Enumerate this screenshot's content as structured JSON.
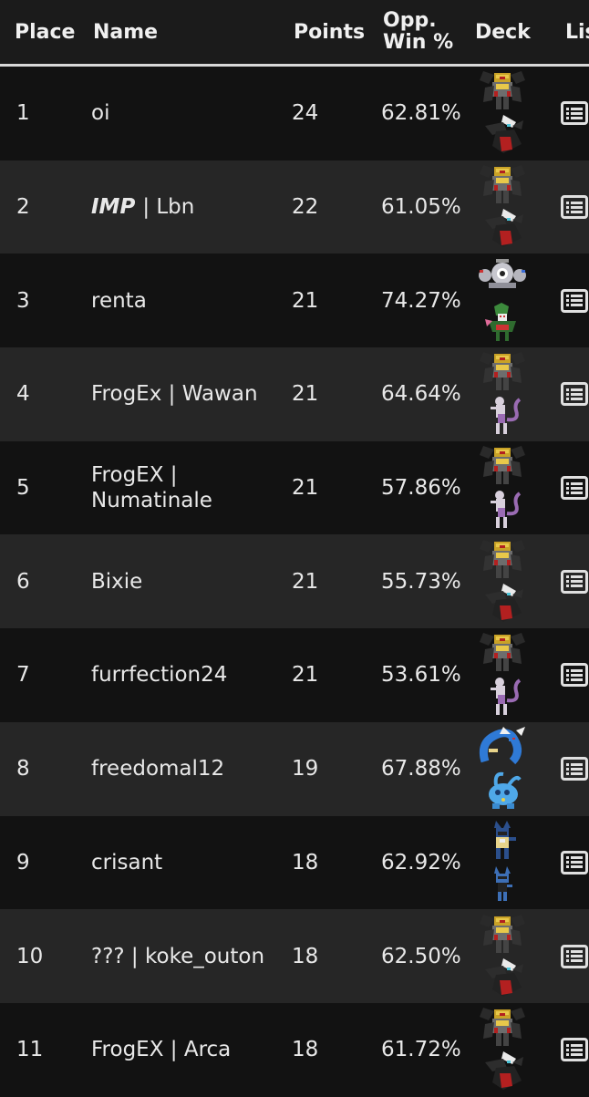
{
  "header": {
    "place": "Place",
    "name": "Name",
    "points": "Points",
    "opp_line1": "Opp.",
    "opp_line2": "Win %",
    "deck": "Deck",
    "list": "Lis"
  },
  "rows": [
    {
      "place": "1",
      "team": "",
      "name": "oi",
      "points": "24",
      "opp": "62.81%",
      "deck": [
        "giratina-sprite",
        "darkrai-sprite"
      ]
    },
    {
      "place": "2",
      "team": "IMP",
      "name": "| Lbn",
      "points": "22",
      "opp": "61.05%",
      "deck": [
        "giratina-sprite",
        "darkrai-sprite"
      ]
    },
    {
      "place": "3",
      "team": "",
      "name": "renta",
      "points": "21",
      "opp": "74.27%",
      "deck": [
        "magnezone-sprite",
        "meowscarada-sprite"
      ]
    },
    {
      "place": "4",
      "team": "",
      "name": "FrogEx | Wawan",
      "points": "21",
      "opp": "64.64%",
      "deck": [
        "giratina-sprite",
        "mewtwo-sprite"
      ]
    },
    {
      "place": "5",
      "team": "",
      "name": "FrogEX | Numatinale",
      "points": "21",
      "opp": "57.86%",
      "deck": [
        "giratina-sprite",
        "mewtwo-sprite"
      ]
    },
    {
      "place": "6",
      "team": "",
      "name": "Bixie",
      "points": "21",
      "opp": "55.73%",
      "deck": [
        "giratina-sprite",
        "darkrai-sprite"
      ]
    },
    {
      "place": "7",
      "team": "",
      "name": "furrfection24",
      "points": "21",
      "opp": "53.61%",
      "deck": [
        "giratina-sprite",
        "mewtwo-sprite"
      ]
    },
    {
      "place": "8",
      "team": "",
      "name": "freedomal12",
      "points": "19",
      "opp": "67.88%",
      "deck": [
        "gyarados-sprite",
        "manaphy-sprite"
      ]
    },
    {
      "place": "9",
      "team": "",
      "name": "crisant",
      "points": "18",
      "opp": "62.92%",
      "deck": [
        "lucario-sprite",
        "riolu-sprite"
      ]
    },
    {
      "place": "10",
      "team": "",
      "name": "??? | koke_outon",
      "points": "18",
      "opp": "62.50%",
      "deck": [
        "giratina-sprite",
        "darkrai-sprite"
      ]
    },
    {
      "place": "11",
      "team": "",
      "name": "FrogEX | Arca",
      "points": "18",
      "opp": "61.72%",
      "deck": [
        "giratina-sprite",
        "darkrai-sprite"
      ]
    }
  ],
  "colors": {
    "row_odd": "#121212",
    "row_even": "#262626",
    "header_border": "#d8d8d8",
    "text": "#e8e8e8"
  }
}
